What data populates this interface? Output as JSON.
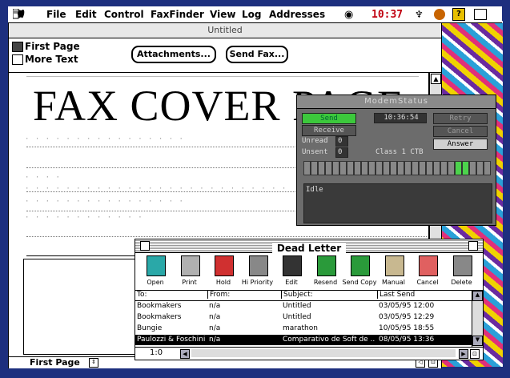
{
  "menubar": {
    "items": [
      "File",
      "Edit",
      "Control",
      "FaxFinder",
      "View",
      "Log",
      "Addresses"
    ],
    "clock": "10:37"
  },
  "main_window": {
    "title": "Untitled",
    "pages": [
      "First Page",
      "More Text"
    ],
    "attachments_label": "Attachments...",
    "send_fax_label": "Send Fax...",
    "document_heading": "FAX COVER PAGE",
    "status_page": "First Page"
  },
  "modem_status": {
    "title": "ModemStatus",
    "send_label": "Send",
    "receive_label": "Receive",
    "time": "10:36:54",
    "retry_label": "Retry",
    "cancel_label": "Cancel",
    "answer_label": "Answer",
    "unread_label": "Unread",
    "unread_value": "0",
    "unsent_label": "Unsent",
    "unsent_value": "0",
    "class_label": "Class 1 CTB",
    "log_text": "Idle"
  },
  "dead_letter": {
    "title": "Dead Letter",
    "tools": [
      "Open",
      "Print",
      "Hold",
      "Hi Priority",
      "Edit",
      "Resend",
      "Send Copy",
      "Manual",
      "Cancel",
      "Delete"
    ],
    "columns": [
      "To:",
      "From:",
      "Subject:",
      "Last Send"
    ],
    "rows": [
      {
        "to": "Bookmakers",
        "from": "n/a",
        "subject": "Untitled",
        "last_send": "03/05/95 12:00"
      },
      {
        "to": "Bookmakers",
        "from": "n/a",
        "subject": "Untitled",
        "last_send": "03/05/95 12:29"
      },
      {
        "to": "Bungie",
        "from": "n/a",
        "subject": "marathon",
        "last_send": "10/05/95 18:55"
      },
      {
        "to": "Paulozzi & Foschini",
        "from": "n/a",
        "subject": "Comparativo de Soft de ...",
        "last_send": "08/05/95 13:36"
      }
    ],
    "footer_count": "1:0"
  }
}
